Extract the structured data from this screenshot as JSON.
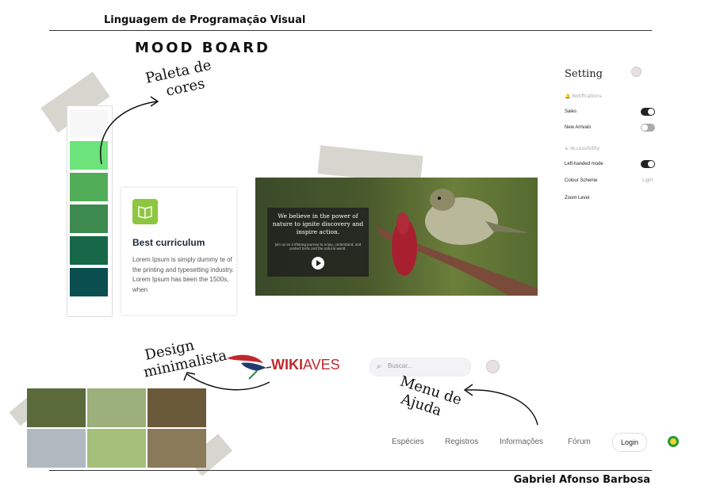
{
  "header": {
    "course_title": "Linguagem de Programação Visual",
    "board_title": "MOOD BOARD"
  },
  "footer": {
    "author": "Gabriel Afonso Barbosa"
  },
  "annotations": {
    "palette": [
      "Paleta de",
      "cores"
    ],
    "design": [
      "Design",
      "minimalista"
    ],
    "help": [
      "Menu de",
      "Ajuda"
    ]
  },
  "palette": [
    "#f7f7f7",
    "#6de37b",
    "#52ad59",
    "#3d8b4e",
    "#166848",
    "#0b4e4f"
  ],
  "card": {
    "icon": "book-icon",
    "title": "Best curriculum",
    "text": "Lorem Ipsum is simply dummy te of the printing and typesetting industry. Lorem Ipsum has been the 1500s, when"
  },
  "hero": {
    "headline": "We believe in the power of nature to ignite discovery and inspire action.",
    "subtext": "Join us on a lifelong journey to enjoy, understand, and protect birds and the natural world.",
    "play_icon": "play-icon"
  },
  "settings": {
    "title": "Setting",
    "notifications_label": "Notifications",
    "sales_label": "Sales",
    "sales_on": true,
    "new_arrivals_label": "New Arrivals",
    "new_arrivals_on": false,
    "accessibility_label": "Accessibility",
    "left_handed_label": "Left-handed mode",
    "left_handed_on": true,
    "colour_scheme_label": "Colour Scheme",
    "colour_scheme_value": "Light",
    "zoom_label": "Zoom Level"
  },
  "wikiaves": {
    "brand_a": "WIKI",
    "brand_b": "AVES"
  },
  "search": {
    "placeholder": "Buscar..."
  },
  "nav": {
    "items": [
      "Espécies",
      "Registros",
      "Informações",
      "Fórum"
    ],
    "login": "Login"
  },
  "colors": {
    "accent_green": "#8dc63f",
    "brand_red": "#c0282d",
    "dark": "#222222"
  }
}
